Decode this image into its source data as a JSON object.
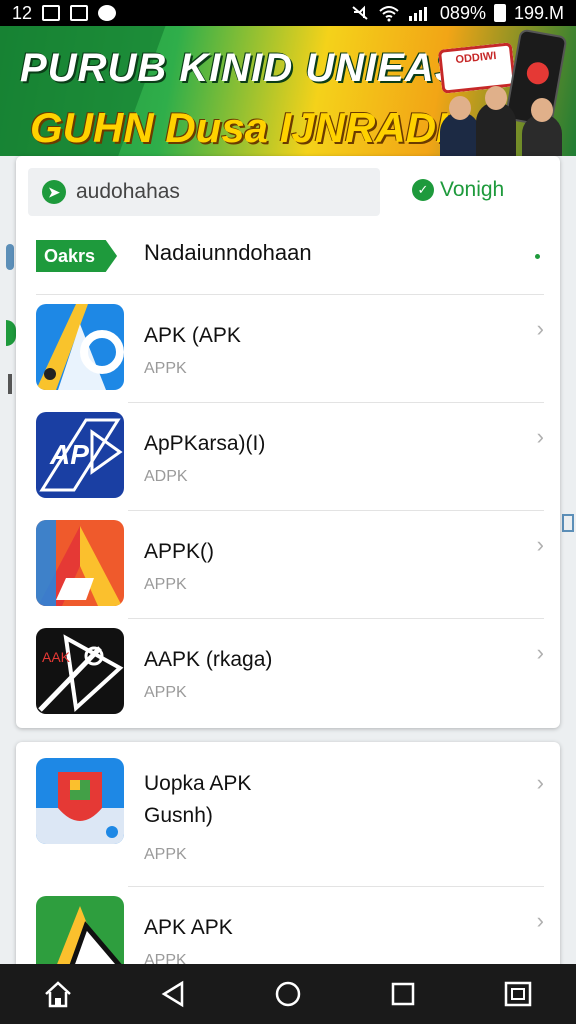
{
  "status_bar": {
    "left_text": "12",
    "battery": "089%",
    "time": "199.M"
  },
  "banner": {
    "line1": "PURUB KINID UNIEASIIA",
    "line2": "GUHN Dusa IJNRADI!",
    "badge": "ODDIWI"
  },
  "search": {
    "text": "audohahas",
    "action_label": "Vonigh"
  },
  "category": {
    "tag": "Oakrs",
    "title": "Nadaiunndohaan"
  },
  "apps": [
    {
      "name": "APK (APK",
      "sub": "APPK"
    },
    {
      "name": "ApPKarsa)(I)",
      "sub": "ADPK"
    },
    {
      "name": "APPK()",
      "sub": "APPK"
    },
    {
      "name": "AAPK (rkaga)",
      "sub": "APPK"
    }
  ],
  "apps2": [
    {
      "name": "Uopka APK\nGusnh)",
      "sub": "APPK"
    },
    {
      "name": "APK APK",
      "sub": "APPK"
    }
  ],
  "nav": {
    "icons": [
      "home-icon",
      "back-icon",
      "home-circle-icon",
      "recents-icon",
      "screenshot-icon"
    ]
  },
  "colors": {
    "accent": "#1e9a3c",
    "nav_bg": "#1a1a1a",
    "status_bg": "#000000"
  }
}
